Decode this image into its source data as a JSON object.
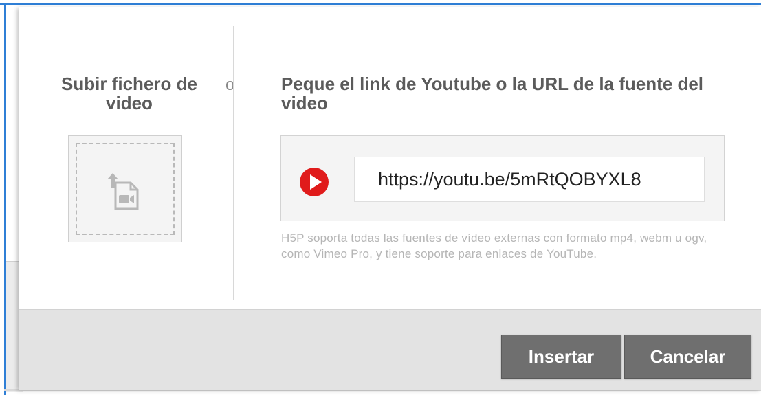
{
  "upload": {
    "title": "Subir fichero de video",
    "icon": "upload-video-file-icon"
  },
  "or_label": "o",
  "url_section": {
    "title": "Peque el link de Youtube o la URL de la fuente del video",
    "input_value": "https://youtu.be/5mRtQOBYXL8",
    "provider_icon": "youtube-play-icon",
    "help_text": "H5P soporta todas las fuentes de vídeo externas con formato mp4, webm u ogv, como Vimeo Pro, y tiene soporte para enlaces de YouTube."
  },
  "buttons": {
    "insert": "Insertar",
    "cancel": "Cancelar"
  },
  "colors": {
    "accent_frame": "#2f7fd6",
    "youtube_red": "#e01b1b",
    "button_bg": "#6f6f6f",
    "footer_bg": "#e3e3e3"
  }
}
